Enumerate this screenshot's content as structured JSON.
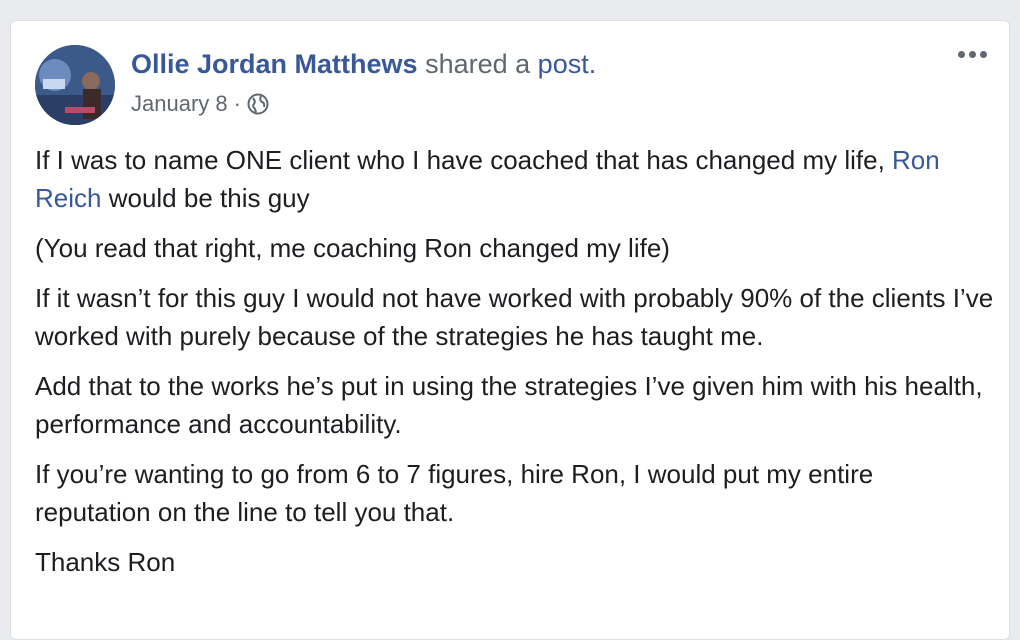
{
  "post": {
    "author": "Ollie Jordan Matthews",
    "action_text": "shared a",
    "post_link": "post.",
    "date": "January 8",
    "separator": "·",
    "avatar_icon": "profile-photo",
    "privacy_icon": "globe-icon",
    "more_icon": "more-options-icon",
    "paragraphs": [
      {
        "before": "If I was to name ONE client who I have coached that has changed my life, ",
        "mention": "Ron Reich",
        "after": " would be this guy"
      },
      {
        "text": "(You read that right, me coaching Ron changed my life)"
      },
      {
        "text": "If it wasn’t for this guy I would not have worked with probably 90% of the clients I’ve worked with purely because of the strategies he has taught me."
      },
      {
        "text": "Add that to the works he’s put in using the strategies I’ve given him with his health, performance and accountability."
      },
      {
        "text": "If you’re wanting to go from 6 to 7 figures, hire Ron, I would put my entire reputation on the line to tell you that."
      },
      {
        "text": "Thanks Ron"
      }
    ]
  },
  "colors": {
    "link": "#385898",
    "meta": "#606770",
    "text": "#1c1e21"
  }
}
